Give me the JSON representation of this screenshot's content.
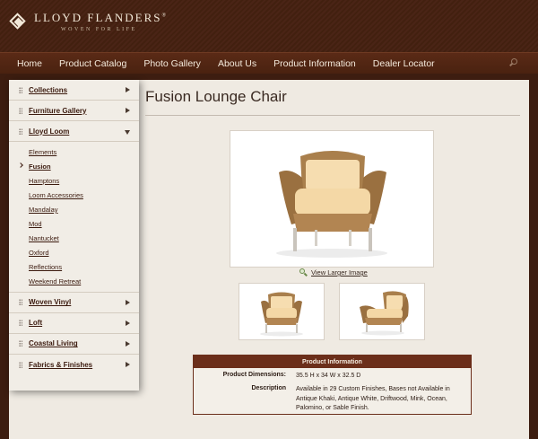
{
  "header": {
    "brand_name": "LLOYD FLANDERS",
    "brand_mark": "®",
    "tagline": "WOVEN FOR LIFE"
  },
  "nav": {
    "items": [
      "Home",
      "Product Catalog",
      "Photo Gallery",
      "About Us",
      "Product Information",
      "Dealer Locator"
    ],
    "search_icon": "search-icon"
  },
  "sidebar": {
    "sections_top": [
      {
        "label": "Collections",
        "state": "collapsed"
      },
      {
        "label": "Furniture Gallery",
        "state": "collapsed"
      },
      {
        "label": "Lloyd Loom",
        "state": "expanded"
      }
    ],
    "sub_items": [
      {
        "label": "Elements",
        "active": false
      },
      {
        "label": "Fusion",
        "active": true
      },
      {
        "label": "Hamptons",
        "active": false
      },
      {
        "label": "Loom Accessories",
        "active": false
      },
      {
        "label": "Mandalay",
        "active": false
      },
      {
        "label": "Mod",
        "active": false
      },
      {
        "label": "Nantucket",
        "active": false
      },
      {
        "label": "Oxford",
        "active": false
      },
      {
        "label": "Reflections",
        "active": false
      },
      {
        "label": "Weekend Retreat",
        "active": false
      }
    ],
    "sections_bottom": [
      {
        "label": "Woven Vinyl",
        "state": "collapsed"
      },
      {
        "label": "Loft",
        "state": "collapsed"
      },
      {
        "label": "Coastal Living",
        "state": "collapsed"
      },
      {
        "label": "Fabrics & Finishes",
        "state": "collapsed"
      }
    ]
  },
  "product": {
    "title": "Fusion Lounge Chair",
    "view_larger": "View Larger Image",
    "info_title": "Product Information",
    "dimensions_label": "Product Dimensions:",
    "dimensions_value": "35.5 H x 34 W x 32.5 D",
    "description_label": "Description",
    "description_value": "Available in 29 Custom Finishes, Bases not Available in Antique Khaki, Antique White, Driftwood, Mink, Ocean, Palomino, or Sable Finish."
  },
  "colors": {
    "header_bg": "#4a2416",
    "nav_bg": "#5a2a16",
    "panel_bg": "#efeae2",
    "accent": "#6b2e1a",
    "link": "#3b1a0e"
  }
}
